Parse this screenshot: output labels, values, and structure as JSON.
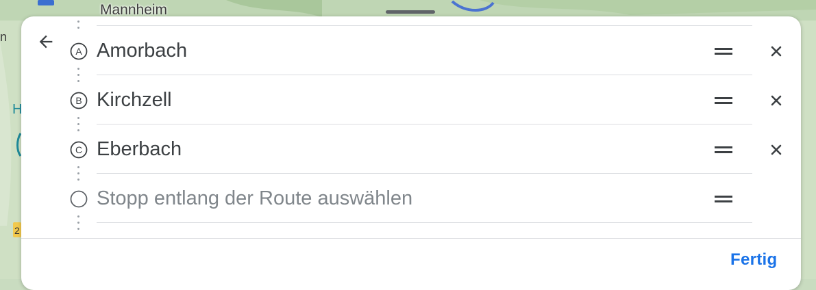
{
  "map": {
    "city_label": "Mannheim"
  },
  "header": {
    "back_icon": "arrow-left-icon"
  },
  "stops": [
    {
      "letter": "A",
      "name": "Amorbach"
    },
    {
      "letter": "B",
      "name": "Kirchzell"
    },
    {
      "letter": "C",
      "name": "Eberbach"
    }
  ],
  "add_stop": {
    "placeholder": "Stopp entlang der Route auswählen"
  },
  "footer": {
    "done_label": "Fertig"
  },
  "colors": {
    "accent": "#1a73e8",
    "text": "#3c4043",
    "placeholder": "#80868b",
    "divider": "#dadce0"
  }
}
